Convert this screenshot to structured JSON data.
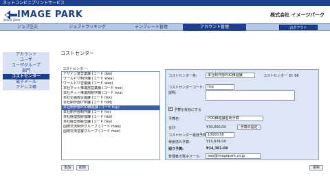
{
  "app": {
    "service_name": "ネットコンビニプリントサービス",
    "logo_text": "IMAGE PARK",
    "logo_sub": "IMAGE PARK",
    "company_name": "株式会社 イメージパーク"
  },
  "nav": {
    "tabs": [
      {
        "label": "ジョブ注文"
      },
      {
        "label": "ジョブトラッキング"
      },
      {
        "label": "テンプレート管理"
      },
      {
        "label": "アカウント管理"
      }
    ],
    "active_index": 3,
    "logout_label": "ログアウト"
  },
  "sidebar": {
    "items": [
      {
        "label": "アカウント"
      },
      {
        "label": "ユーザ"
      },
      {
        "label": "ユーザグループ"
      },
      {
        "label": "部門"
      },
      {
        "label": "コストセンター"
      },
      {
        "label": "電子メール"
      },
      {
        "label": "アドレス帳"
      }
    ],
    "active_index": 4
  },
  "page": {
    "title": "コストセンター"
  },
  "list": {
    "label": "コストセンター:",
    "items": [
      {
        "label": "デザイン室営業課 (コード dee)"
      },
      {
        "label": "ワールドワ制作課 (コード wwa)"
      },
      {
        "label": "ワールドワ営業課 (コード wee)"
      },
      {
        "label": "本社ネット推進部営業課 (コード hne)"
      },
      {
        "label": "本社ネット推進部制作課 (コード hna)"
      },
      {
        "label": "本社企画部企画課 (コード hkk)"
      },
      {
        "label": "本社制作部DTP課 (コード hdd)"
      },
      {
        "label": "本社制作部POD推進課 (コード hsp)"
      },
      {
        "label": "本社制作部制作課 (コード hsi)"
      },
      {
        "label": "本社経理部経理課 (コード hkb)"
      },
      {
        "label": "本社経営部経営課 (コード hke)"
      },
      {
        "label": "国際交流制作グループ (コード mwa)"
      },
      {
        "label": "国際交流営業グループ (コード mee)"
      }
    ],
    "selected_index": 7,
    "add_label": "追加",
    "delete_label": "削除"
  },
  "detail": {
    "name_label": "コストセンター名:",
    "name_value": "本社制作部POD推進課",
    "id_text": "コストセンター ID: 66",
    "code_label": "コストセンターコード:",
    "code_value": "hsp",
    "desc_label": "説明:",
    "budget_enable_label": "予算を有効にする",
    "budget_enable_checked": "✔",
    "budget_name_label": "予算名:",
    "budget_name_value": "POD推進課名刺予算",
    "total_label": "合計:",
    "total_value": "¥30,000.00",
    "budget_settings_label": "予算の設定",
    "min_budget_label": "コストセンター最低予算:",
    "min_budget_value": "10000.00",
    "used_label": "使用済み予算:",
    "used_value": "¥15,639.00",
    "remaining_label": "残り予算:",
    "remaining_value": "¥14,361.00",
    "admin_email_label": "管理者の電子メール:",
    "admin_email_value": "aaa@imagepark.co.jp",
    "update_label": "更新"
  }
}
